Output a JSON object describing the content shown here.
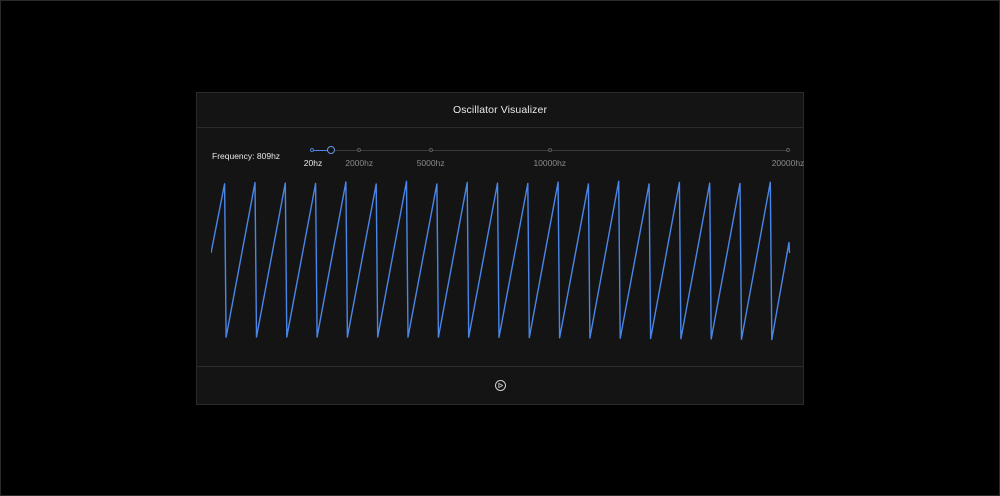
{
  "app": {
    "title": "Oscillator Visualizer"
  },
  "frequency": {
    "label": "Frequency: 809hz",
    "value_hz": 809,
    "min_hz": 20,
    "max_hz": 20000
  },
  "slider": {
    "ticks": [
      {
        "value": 20,
        "label": "20hz",
        "current": true
      },
      {
        "value": 2000,
        "label": "2000hz",
        "current": false
      },
      {
        "value": 5000,
        "label": "5000hz",
        "current": false
      },
      {
        "value": 10000,
        "label": "10000hz",
        "current": false
      },
      {
        "value": 20000,
        "label": "20000hz",
        "current": false
      }
    ]
  },
  "waveform": {
    "type": "sawtooth",
    "color": "#4a86e8",
    "cycles_visible": 19
  },
  "controls": {
    "play_icon": "play-circle-icon"
  },
  "colors": {
    "background": "#000000",
    "panel": "#141414",
    "accent": "#4a86e8"
  }
}
